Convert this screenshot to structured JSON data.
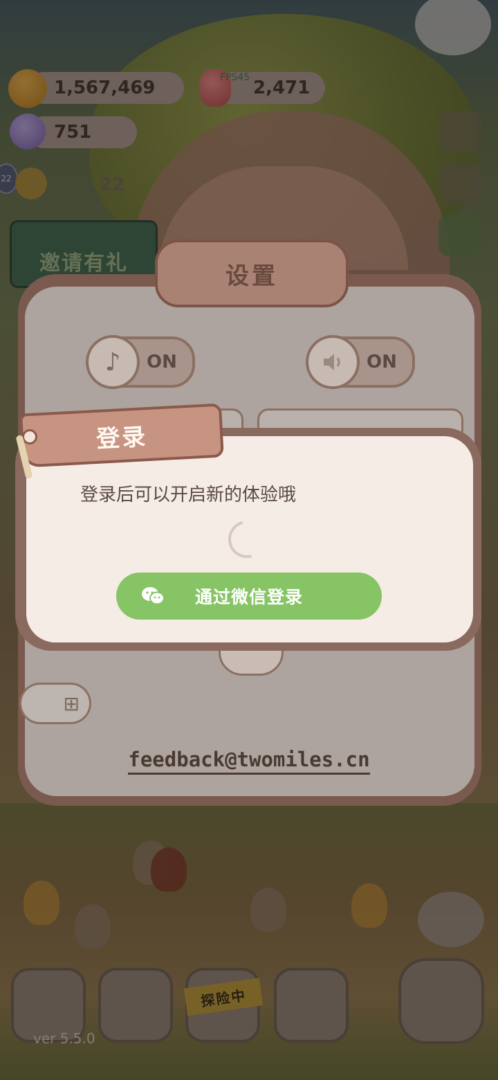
{
  "resources": {
    "cookies": "1,567,469",
    "jelly": "2,471",
    "gems": "751",
    "fps_label": "FPS45"
  },
  "hud": {
    "level_badge": "22",
    "level_count": "22",
    "invite_label": "邀请有礼"
  },
  "settings": {
    "title": "设置",
    "music_state": "ON",
    "sound_state": "ON",
    "feedback_email": "feedback@twomiles.cn"
  },
  "login_dialog": {
    "title": "登录",
    "message": "登录后可以开启新的体验哦",
    "wechat_button_label": "通过微信登录"
  },
  "bottom_nav": {
    "explore_label": "探险中"
  },
  "footer": {
    "version": "ver 5.5.0"
  },
  "colors": {
    "wechat_green": "#86c465",
    "dialog_bg": "#f6ece6",
    "panel_border": "#8a6a5e"
  },
  "icons": [
    "cookie-icon",
    "jelly-icon",
    "gem-icon",
    "music-note-icon",
    "speaker-icon",
    "wechat-icon",
    "loading-spinner"
  ]
}
